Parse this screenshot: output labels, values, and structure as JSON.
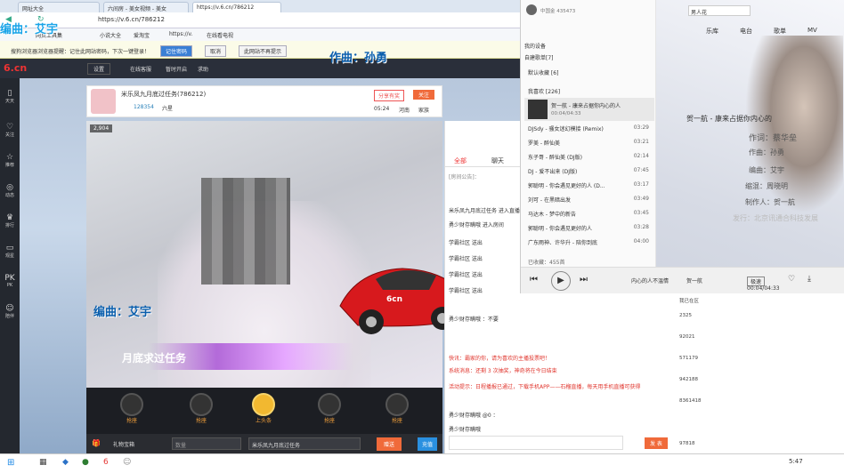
{
  "browser": {
    "tabs": [
      "网址大全",
      "六间房 - 美女视频 - 美女",
      "https://v.6.cn/786212"
    ],
    "address": "https://v.6.cn/786212",
    "favorites": [
      "网页工具集",
      "小说大全",
      "爱淘宝",
      "https://v.",
      "在线看电视"
    ],
    "infobar_text": "搜狗浏览器浏览器提醒：记住此网站密码，下次一键登录！",
    "infobar_buttons": [
      "记住密码",
      "取消",
      "此网站不再提示"
    ]
  },
  "site": {
    "logo": "6.cn",
    "nav": [
      "设置",
      "在线客服",
      "暂时开启",
      "求助"
    ],
    "sidebar": [
      "天天",
      "关注",
      "推荐",
      "动态",
      "排行",
      "观星",
      "PK",
      "陪伴"
    ]
  },
  "anchor": {
    "title": "米乐凤九月底过任务(786212)",
    "fans": "128354",
    "level": "六星",
    "share_label": "分享有奖",
    "follow_label": "关注",
    "time": "05:24",
    "location": "河南",
    "family": "家族",
    "viewers": "2,904"
  },
  "overlay": {
    "composer_line1": "编曲：艾宇",
    "composer_line2": "作曲：孙勇",
    "subtitle": "月底求过任务",
    "car_label": "6cn"
  },
  "seats": [
    "抢座",
    "抢座",
    "上头条",
    "抢座",
    "抢座"
  ],
  "giftbar": {
    "gift_label": "礼物宝箱",
    "count_placeholder": "数量",
    "target": "米乐凤九月底过任务",
    "send": "赠送",
    "charge": "充值"
  },
  "chat": {
    "tabs": [
      "全部",
      "聊天"
    ],
    "notice": "[房间公告]：",
    "lines": [
      "米乐凤九月底过任务 进入直播间",
      "勇少财存瞒哦 进入房间",
      "学霸社区 送出",
      "学霸社区 送出",
      "学霸社区 送出",
      "学霸社区 送出",
      "勇少财存瞒哦 ：不要",
      "快讯：霸家的你，请为喜欢的主播投票吧！",
      "系统消息：还剩 3 次抽奖，神奇将在今日结束",
      "活动提示：日程播报已通过，下载手机APP——石榴直播，每天用手机直播可获得",
      "勇少财存瞒哦 @0 ：",
      "勇少财存瞒哦"
    ],
    "input_placeholder": "",
    "send": "发 表"
  },
  "music": {
    "user": "中国金 435473",
    "sidebar_items": [
      "我的设备",
      "自建歌单[7]",
      "默认收藏 [6]",
      "我喜欢 [226]"
    ],
    "now_playing_title": "贺一航 - 康来占据你内心的人",
    "now_playing_time": "00:04/04:33",
    "songs": [
      {
        "title": "DJSdy - 骚女迷幻模接 (Remix)",
        "dur": "03:29"
      },
      {
        "title": "罗美 - 醉仙美",
        "dur": "03:21"
      },
      {
        "title": "东子哥 - 醉仙美 (DJ版)",
        "dur": "02:14"
      },
      {
        "title": "DJ - 爱不出来 (DJ版)",
        "dur": "07:45"
      },
      {
        "title": "郭聪明 - 你会遇见更好的人 (D...",
        "dur": "03:17"
      },
      {
        "title": "刘可 - 在黑暗出发",
        "dur": "03:49"
      },
      {
        "title": "马达木 - 梦中的新告",
        "dur": "03:45"
      },
      {
        "title": "郭聪明 - 你会遇见更好的人",
        "dur": "03:28"
      },
      {
        "title": "广东雨神、许华升 - 陪你到底",
        "dur": "04:00"
      }
    ],
    "total": "已收藏：455首",
    "tabs": [
      "乐库",
      "电台",
      "歌单",
      "MV"
    ],
    "search_placeholder": "男人花",
    "lyric_main": "贺一航 - 康来占据你内心的",
    "lyric_lines": [
      "作词：蔡华垒",
      "作曲：孙勇",
      "编曲：艾宇",
      "缩混：周晓明",
      "制作人：贺一航",
      "发行：北京讯通合科技发展"
    ],
    "bottom_song": "内心的人不温情",
    "bottom_artist": "贺一航",
    "bottom_time": "00:04/04:33",
    "lossless": "极速"
  },
  "rightlist": {
    "header": "我已在区",
    "rows": [
      "2325",
      "92021",
      "571179",
      "942188",
      "8361418",
      "97818"
    ]
  },
  "taskbar": {
    "time": "5:47"
  }
}
